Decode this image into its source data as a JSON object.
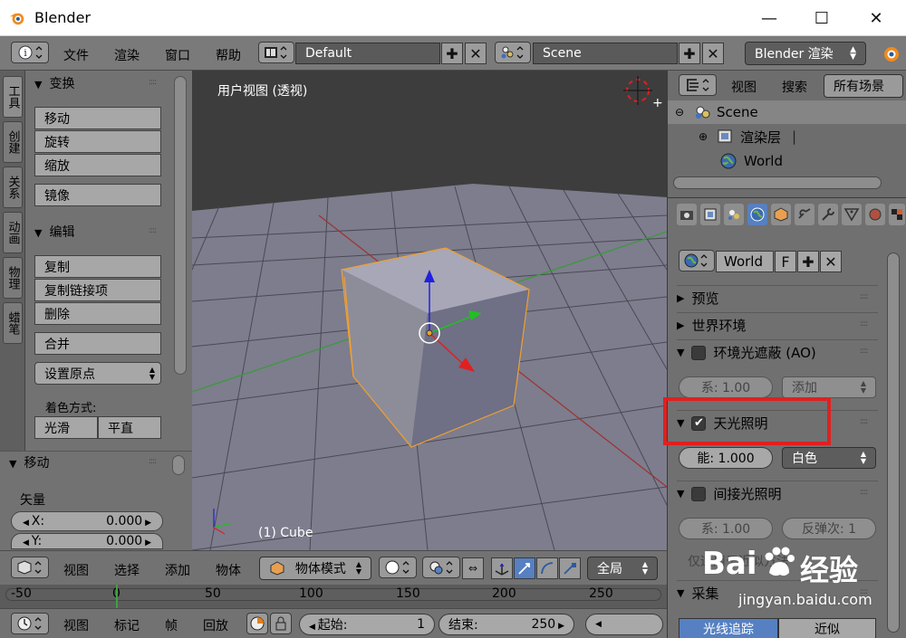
{
  "window": {
    "title": "Blender",
    "minimize_icon": "—",
    "maximize_icon": "☐",
    "close_icon": "✕"
  },
  "topbar": {
    "menus": [
      "文件",
      "渲染",
      "窗口",
      "帮助"
    ],
    "screen_layout": "Default",
    "scene": "Scene",
    "render_engine": "Blender 渲染"
  },
  "tool_tabs": [
    "工具",
    "创建",
    "关系",
    "动画",
    "物理",
    "蜡笔"
  ],
  "tool_shelf": {
    "transform": {
      "title": "变换",
      "buttons": [
        "移动",
        "旋转",
        "缩放",
        "镜像"
      ]
    },
    "edit": {
      "title": "编辑",
      "buttons": [
        "复制",
        "复制链接项",
        "删除",
        "合并"
      ],
      "origin_dropdown": "设置原点",
      "shading_label": "着色方式:",
      "shading_smooth": "光滑",
      "shading_flat": "平直"
    }
  },
  "move_panel": {
    "title": "移动",
    "vector_label": "矢量",
    "x_label": "X:",
    "x_value": "0.000",
    "y_label": "Y:",
    "y_value": "0.000"
  },
  "viewport": {
    "view_label": "用户视图 (透视)",
    "object_label": "(1) Cube"
  },
  "viewport_header": {
    "menus": [
      "视图",
      "选择",
      "添加",
      "物体"
    ],
    "mode": "物体模式",
    "orientation": "全局"
  },
  "timeline": {
    "ticks": [
      "-50",
      "0",
      "50",
      "100",
      "150",
      "200",
      "250"
    ]
  },
  "timeline_bar": {
    "menus": [
      "视图",
      "标记",
      "帧",
      "回放"
    ],
    "start_label": "起始:",
    "start_value": "1",
    "end_label": "结束:",
    "end_value": "250"
  },
  "outliner": {
    "menus": [
      "视图",
      "搜索"
    ],
    "filter": "所有场景",
    "items": [
      "Scene",
      "渲染层",
      "World"
    ]
  },
  "properties": {
    "world_name": "World",
    "fake_user": "F",
    "panels": {
      "preview": "预览",
      "world_env": "世界环境",
      "ao": "环境光遮蔽 (AO)",
      "ao_factor": "系: 1.00",
      "ao_blend": "添加",
      "env_light": "天光照明",
      "env_energy": "能: 1.000",
      "env_color": "白色",
      "indirect": "间接光照明",
      "indirect_factor": "系: 1.00",
      "indirect_bounces": "反弹次: 1",
      "indirect_note": "仅适用于近似方法",
      "gather": "采集",
      "gather_raytrace": "光线追踪",
      "gather_approx": "近似"
    }
  },
  "watermark": {
    "brand": "Bai",
    "brand_cn": "经验",
    "url": "jingyan.baidu.com"
  },
  "colors": {
    "accent_blue": "#5680c2",
    "highlight_red": "#e02020",
    "selection_orange": "#f0a030"
  }
}
